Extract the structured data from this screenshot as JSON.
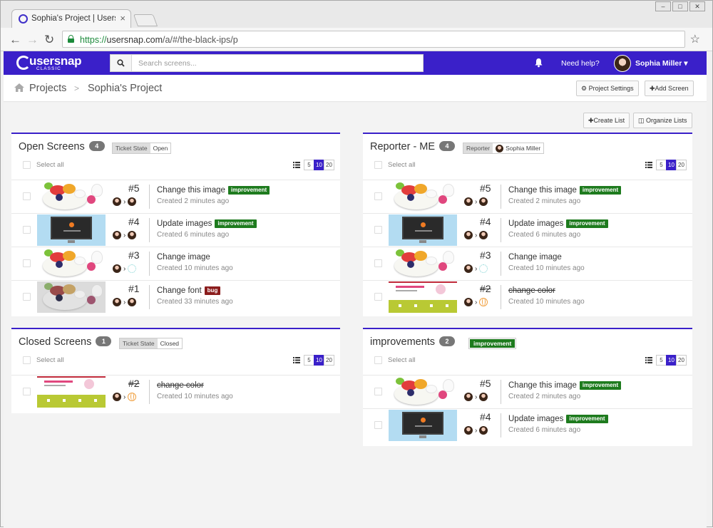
{
  "browser": {
    "tab_title": "Sophia's Project | Usersn",
    "url_scheme": "https://",
    "url_host": "usersnap.com",
    "url_path": "/a/#/the-black-ips/p"
  },
  "app": {
    "logo": "usersnap",
    "logo_sub": "CLASSIC",
    "search_placeholder": "Search screens...",
    "help": "Need help?",
    "user_name": "Sophia Miller"
  },
  "breadcrumb": {
    "projects": "Projects",
    "separator": ">",
    "project": "Sophia's Project"
  },
  "actions": {
    "project_settings": "Project Settings",
    "add_screen": "Add Screen",
    "create_list": "Create List",
    "organize_lists": "Organize Lists"
  },
  "common": {
    "select_all": "Select all",
    "pages": [
      "5",
      "10",
      "20"
    ]
  },
  "panels": {
    "open": {
      "title": "Open Screens",
      "count": "4",
      "filter_key": "Ticket State",
      "filter_value": "Open",
      "rows": [
        {
          "num": "#5",
          "title": "Change this image",
          "badge": "improvement",
          "created": "Created 2 minutes ago"
        },
        {
          "num": "#4",
          "title": "Update images",
          "badge": "improvement",
          "created": "Created 6 minutes ago"
        },
        {
          "num": "#3",
          "title": "Change image",
          "badge": "",
          "created": "Created 10 minutes ago"
        },
        {
          "num": "#1",
          "title": "Change font",
          "badge": "bug",
          "created": "Created 33 minutes ago"
        }
      ]
    },
    "reporter": {
      "title": "Reporter - ME",
      "count": "4",
      "filter_key": "Reporter",
      "filter_value": "Sophia Miller",
      "rows": [
        {
          "num": "#5",
          "title": "Change this image",
          "badge": "improvement",
          "created": "Created 2 minutes ago"
        },
        {
          "num": "#4",
          "title": "Update images",
          "badge": "improvement",
          "created": "Created 6 minutes ago"
        },
        {
          "num": "#3",
          "title": "Change image",
          "badge": "",
          "created": "Created 10 minutes ago"
        },
        {
          "num": "#2",
          "title": "change color",
          "badge": "",
          "created": "Created 10 minutes ago"
        }
      ]
    },
    "closed": {
      "title": "Closed Screens",
      "count": "1",
      "filter_key": "Ticket State",
      "filter_value": "Closed",
      "rows": [
        {
          "num": "#2",
          "title": "change color",
          "badge": "",
          "created": "Created 10 minutes ago"
        }
      ]
    },
    "improvements": {
      "title": "improvements",
      "count": "2",
      "filter_value": "improvement",
      "rows": [
        {
          "num": "#5",
          "title": "Change this image",
          "badge": "improvement",
          "created": "Created 2 minutes ago"
        },
        {
          "num": "#4",
          "title": "Update images",
          "badge": "improvement",
          "created": "Created 6 minutes ago"
        }
      ]
    }
  },
  "colors": {
    "brand": "#3a20c9",
    "improvement": "#1e7b1e",
    "bug": "#8b1d1d"
  }
}
